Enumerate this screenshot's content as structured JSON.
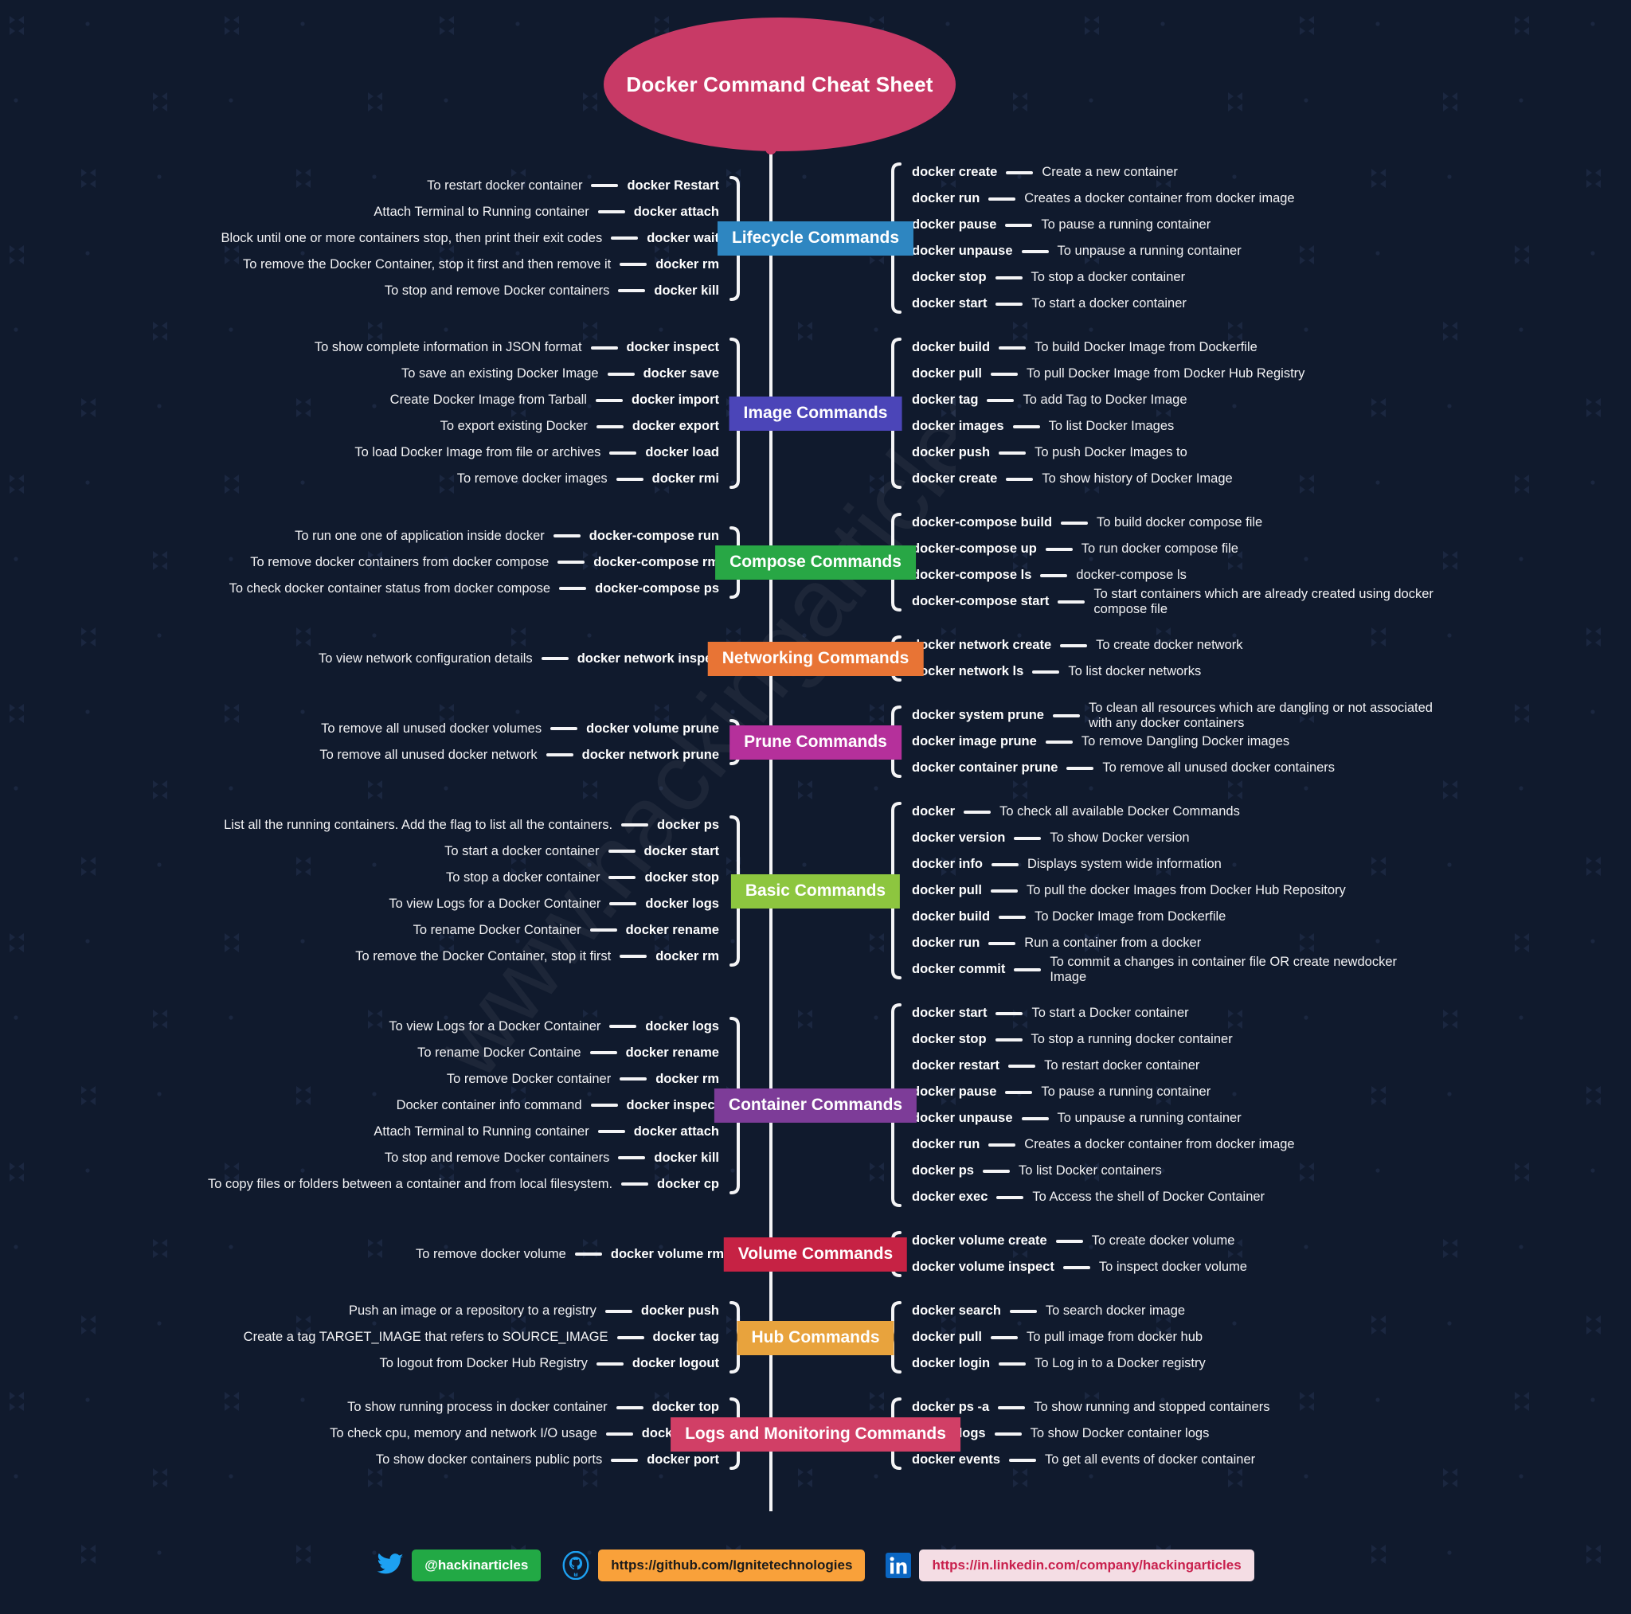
{
  "title": "Docker Command Cheat Sheet",
  "colors": {
    "background": "#101a2d",
    "root": "#c83a66",
    "spine": "#f4f4f6",
    "lifecycle": "#2e86c1",
    "image": "#4b45b8",
    "compose": "#28a745",
    "networking": "#e87435",
    "prune": "#b5309b",
    "basic": "#8dc63f",
    "container": "#7d3c98",
    "volume": "#c62244",
    "hub": "#e8a33d",
    "logs": "#d13f66"
  },
  "branches": [
    {
      "label": "Lifecycle Commands",
      "color_key": "lifecycle",
      "color": "#2e86c1",
      "left": [
        {
          "desc": "To restart docker container",
          "cmd": "docker Restart"
        },
        {
          "desc": "Attach Terminal to Running container",
          "cmd": "docker attach"
        },
        {
          "desc": "Block until one or more containers stop, then print their exit codes",
          "cmd": "docker wait"
        },
        {
          "desc": "To remove the Docker Container, stop it first and then remove it",
          "cmd": "docker rm"
        },
        {
          "desc": "To stop and remove Docker containers",
          "cmd": "docker kill"
        }
      ],
      "right": [
        {
          "cmd": "docker create",
          "desc": "Create a new container"
        },
        {
          "cmd": "docker run",
          "desc": "Creates a docker container from docker image"
        },
        {
          "cmd": "docker pause",
          "desc": "To pause a running container"
        },
        {
          "cmd": "docker unpause",
          "desc": "To unpause a running container"
        },
        {
          "cmd": "docker stop",
          "desc": "To stop a docker container"
        },
        {
          "cmd": "docker start",
          "desc": "To start a docker container"
        }
      ]
    },
    {
      "label": "Image Commands",
      "color_key": "image",
      "color": "#4b45b8",
      "left": [
        {
          "desc": "To show complete information in JSON format",
          "cmd": "docker inspect"
        },
        {
          "desc": "To save an existing Docker Image",
          "cmd": "docker save"
        },
        {
          "desc": "Create Docker Image from Tarball",
          "cmd": "docker import"
        },
        {
          "desc": "To export existing Docker",
          "cmd": "docker export"
        },
        {
          "desc": "To load Docker Image from file or archives",
          "cmd": "docker load"
        },
        {
          "desc": "To remove docker images",
          "cmd": "docker rmi"
        }
      ],
      "right": [
        {
          "cmd": "docker build",
          "desc": "To build Docker Image from Dockerfile"
        },
        {
          "cmd": "docker pull",
          "desc": "To pull Docker Image from Docker Hub Registry"
        },
        {
          "cmd": "docker tag",
          "desc": "To add Tag to Docker Image"
        },
        {
          "cmd": "docker images",
          "desc": "To list Docker Images"
        },
        {
          "cmd": "docker push",
          "desc": "To push Docker Images to"
        },
        {
          "cmd": "docker create",
          "desc": "To show history of Docker Image"
        }
      ]
    },
    {
      "label": "Compose Commands",
      "color_key": "compose",
      "color": "#28a745",
      "left": [
        {
          "desc": "To run one one of application inside docker",
          "cmd": "docker-compose run"
        },
        {
          "desc": "To remove docker containers from docker compose",
          "cmd": "docker-compose rm"
        },
        {
          "desc": "To check docker container status from docker compose",
          "cmd": "docker-compose ps"
        }
      ],
      "right": [
        {
          "cmd": "docker-compose build",
          "desc": "To build docker compose file"
        },
        {
          "cmd": "docker-compose up",
          "desc": "To run docker compose file"
        },
        {
          "cmd": "docker-compose ls",
          "desc": "docker-compose ls"
        },
        {
          "cmd": "docker-compose start",
          "desc": "To start containers which are already created using docker compose file"
        }
      ]
    },
    {
      "label": "Networking Commands",
      "color_key": "networking",
      "color": "#e87435",
      "left": [
        {
          "desc": "To view network configuration details",
          "cmd": "docker network inspect"
        }
      ],
      "right": [
        {
          "cmd": "docker network create",
          "desc": "To create docker network"
        },
        {
          "cmd": "docker network ls",
          "desc": "To list docker networks"
        }
      ]
    },
    {
      "label": "Prune Commands",
      "color_key": "prune",
      "color": "#b5309b",
      "left": [
        {
          "desc": "To remove all unused docker volumes",
          "cmd": "docker volume prune"
        },
        {
          "desc": "To remove all unused docker network",
          "cmd": "docker network prune"
        }
      ],
      "right": [
        {
          "cmd": "docker system prune",
          "desc": "To clean all resources which are dangling or not associated with any docker containers"
        },
        {
          "cmd": "docker image prune",
          "desc": "To remove Dangling Docker images"
        },
        {
          "cmd": "docker container prune",
          "desc": "To remove all unused docker containers"
        }
      ]
    },
    {
      "label": "Basic Commands",
      "color_key": "basic",
      "color": "#8dc63f",
      "left": [
        {
          "desc": "List all the running containers. Add the flag to list all the containers.",
          "cmd": "docker ps"
        },
        {
          "desc": "To start a docker container",
          "cmd": "docker start"
        },
        {
          "desc": "To stop a docker container",
          "cmd": "docker stop"
        },
        {
          "desc": "To view Logs for a Docker Container",
          "cmd": "docker logs"
        },
        {
          "desc": "To rename Docker Container",
          "cmd": "docker rename"
        },
        {
          "desc": "To remove the Docker Container, stop it first",
          "cmd": "docker rm"
        }
      ],
      "right": [
        {
          "cmd": "docker",
          "desc": "To check all available Docker Commands"
        },
        {
          "cmd": "docker version",
          "desc": "To show Docker version"
        },
        {
          "cmd": "docker info",
          "desc": "Displays system wide information"
        },
        {
          "cmd": "docker pull",
          "desc": "To pull the docker Images from Docker Hub Repository"
        },
        {
          "cmd": "docker build",
          "desc": "To Docker Image from Dockerfile"
        },
        {
          "cmd": "docker run",
          "desc": "Run a container from a docker"
        },
        {
          "cmd": "docker commit",
          "desc": "To commit a changes in container file OR create newdocker Image"
        }
      ]
    },
    {
      "label": "Container Commands",
      "color_key": "container",
      "color": "#7d3c98",
      "left": [
        {
          "desc": "To view Logs for a Docker Container",
          "cmd": "docker logs"
        },
        {
          "desc": "To rename Docker Containe",
          "cmd": "docker rename"
        },
        {
          "desc": "To remove Docker container",
          "cmd": "docker rm"
        },
        {
          "desc": "Docker container info command",
          "cmd": "docker inspect"
        },
        {
          "desc": "Attach Terminal to Running container",
          "cmd": "docker attach"
        },
        {
          "desc": "To stop and remove Docker containers",
          "cmd": "docker kill"
        },
        {
          "desc": "To copy files or folders between a container and from local filesystem.",
          "cmd": "docker cp"
        }
      ],
      "right": [
        {
          "cmd": "docker start",
          "desc": "To start a Docker container"
        },
        {
          "cmd": "docker stop",
          "desc": "To stop a running docker container"
        },
        {
          "cmd": "docker restart",
          "desc": "To restart docker container"
        },
        {
          "cmd": "docker pause",
          "desc": "To pause a running container"
        },
        {
          "cmd": "docker unpause",
          "desc": "To unpause a running container"
        },
        {
          "cmd": "docker run",
          "desc": "Creates a docker container from docker image"
        },
        {
          "cmd": "docker ps",
          "desc": "To list Docker containers"
        },
        {
          "cmd": "docker exec",
          "desc": "To Access the shell of Docker Container"
        }
      ]
    },
    {
      "label": "Volume Commands",
      "color_key": "volume",
      "color": "#c62244",
      "left": [
        {
          "desc": "To remove docker volume",
          "cmd": "docker volume rm"
        }
      ],
      "right": [
        {
          "cmd": "docker volume create",
          "desc": "To create docker volume"
        },
        {
          "cmd": "docker volume inspect",
          "desc": "To inspect docker volume"
        }
      ]
    },
    {
      "label": "Hub Commands",
      "color_key": "hub",
      "color": "#e8a33d",
      "left": [
        {
          "desc": "Push an image or a repository to a registry",
          "cmd": "docker push"
        },
        {
          "desc": "Create a tag TARGET_IMAGE that refers to SOURCE_IMAGE",
          "cmd": "docker tag"
        },
        {
          "desc": "To logout from Docker Hub Registry",
          "cmd": "docker logout"
        }
      ],
      "right": [
        {
          "cmd": "docker search",
          "desc": "To search docker image"
        },
        {
          "cmd": "docker pull",
          "desc": "To pull image from docker hub"
        },
        {
          "cmd": "docker login",
          "desc": "To Log in to a Docker registry"
        }
      ]
    },
    {
      "label": "Logs and Monitoring Commands",
      "color_key": "logs",
      "color": "#d13f66",
      "left": [
        {
          "desc": "To show running process in docker container",
          "cmd": "docker top"
        },
        {
          "desc": "To check cpu, memory and network I/O usage",
          "cmd": "docker stats"
        },
        {
          "desc": "To show docker containers public ports",
          "cmd": "docker port"
        }
      ],
      "right": [
        {
          "cmd": "docker ps -a",
          "desc": "To show running and stopped containers"
        },
        {
          "cmd": "docker logs",
          "desc": "To show Docker container logs"
        },
        {
          "cmd": "docker events",
          "desc": "To get all events of docker container"
        }
      ]
    }
  ],
  "footer": {
    "socials": [
      {
        "icon": "twitter-icon",
        "label": "@hackinarticles",
        "pill_class": "pill-twitter"
      },
      {
        "icon": "github-icon",
        "label": "https://github.com/Ignitetechnologies",
        "pill_class": "pill-github"
      },
      {
        "icon": "linkedin-icon",
        "label": "https://in.linkedin.com/company/hackingarticles",
        "pill_class": "pill-linkedin"
      }
    ]
  },
  "watermark": "www.hackingarticles.in"
}
